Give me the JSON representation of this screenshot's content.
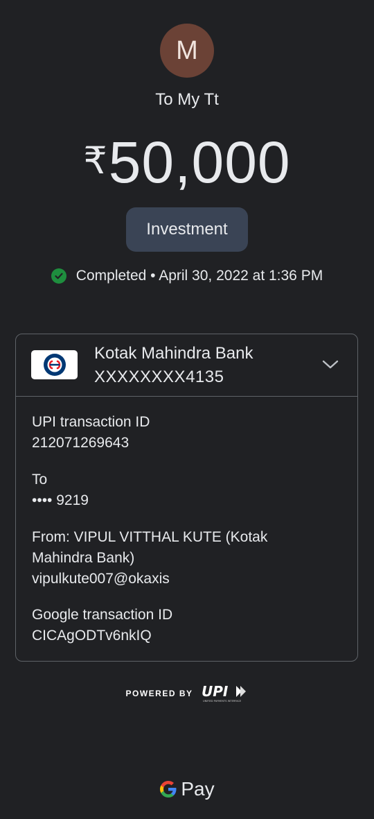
{
  "payee": {
    "initial": "M",
    "name": "To My Tt"
  },
  "amount": {
    "currency_symbol": "₹",
    "value": "50,000"
  },
  "note": "Investment",
  "status": {
    "icon": "check-circle-icon",
    "text": "Completed • April 30, 2022 at 1:36 PM",
    "color": "#1e8e3e"
  },
  "bank": {
    "name": "Kotak Mahindra Bank",
    "account": "XXXXXXXX4135",
    "logo_icon": "kotak-logo-icon",
    "expand_icon": "chevron-down-icon"
  },
  "details": {
    "upi_label": "UPI transaction ID",
    "upi_id": "212071269643",
    "to_label": "To",
    "to_value": "•••• 9219",
    "from_label": "From: VIPUL VITTHAL KUTE (Kotak Mahindra Bank)",
    "from_value": "vipulkute007@okaxis",
    "google_label": "Google transaction ID",
    "google_id": "CICAgODTv6nkIQ"
  },
  "footer": {
    "powered_by": "POWERED BY",
    "upi_logo_text": "UPI",
    "upi_tagline": "UNIFIED PAYMENTS INTERFACE",
    "gpay_text": "Pay"
  },
  "colors": {
    "background": "#202124",
    "avatar": "#6b4236",
    "chip": "#3a4455",
    "border": "#5f6368"
  }
}
